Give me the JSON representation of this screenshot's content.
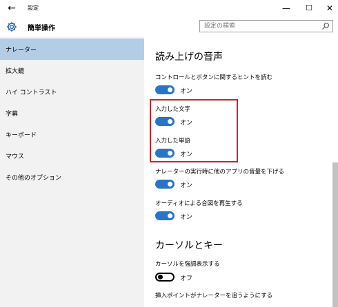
{
  "window": {
    "title": "設定",
    "back_icon": "←",
    "minimize_icon": "—",
    "maximize_icon": "☐",
    "close_icon": "✕"
  },
  "header": {
    "title": "簡単操作",
    "search_placeholder": "設定の検索"
  },
  "sidebar": {
    "items": [
      {
        "label": "ナレーター",
        "active": true
      },
      {
        "label": "拡大鏡"
      },
      {
        "label": "ハイ コントラスト"
      },
      {
        "label": "字幕"
      },
      {
        "label": "キーボード"
      },
      {
        "label": "マウス"
      },
      {
        "label": "その他のオプション"
      }
    ]
  },
  "main": {
    "section1": {
      "title": "読み上げの音声",
      "settings": [
        {
          "label": "コントロールとボタンに関するヒントを読む",
          "state": "オン"
        },
        {
          "label": "入力した文字",
          "state": "オン"
        },
        {
          "label": "入力した単語",
          "state": "オン"
        },
        {
          "label": "ナレーターの実行時に他のアプリの音量を下げる",
          "state": "オン"
        },
        {
          "label": "オーディオによる合図を再生する",
          "state": "オン"
        }
      ]
    },
    "section2": {
      "title": "カーソルとキー",
      "settings": [
        {
          "label": "カーソルを強調表示する",
          "state": "オフ"
        },
        {
          "label": "挿入ポイントがナレーターを追うようにする"
        }
      ]
    }
  },
  "colors": {
    "toggle_on": "#2874c8",
    "nav_active": "#b4cde6",
    "sidebar_bg": "#f2f2f2",
    "highlight": "#d0202a"
  }
}
